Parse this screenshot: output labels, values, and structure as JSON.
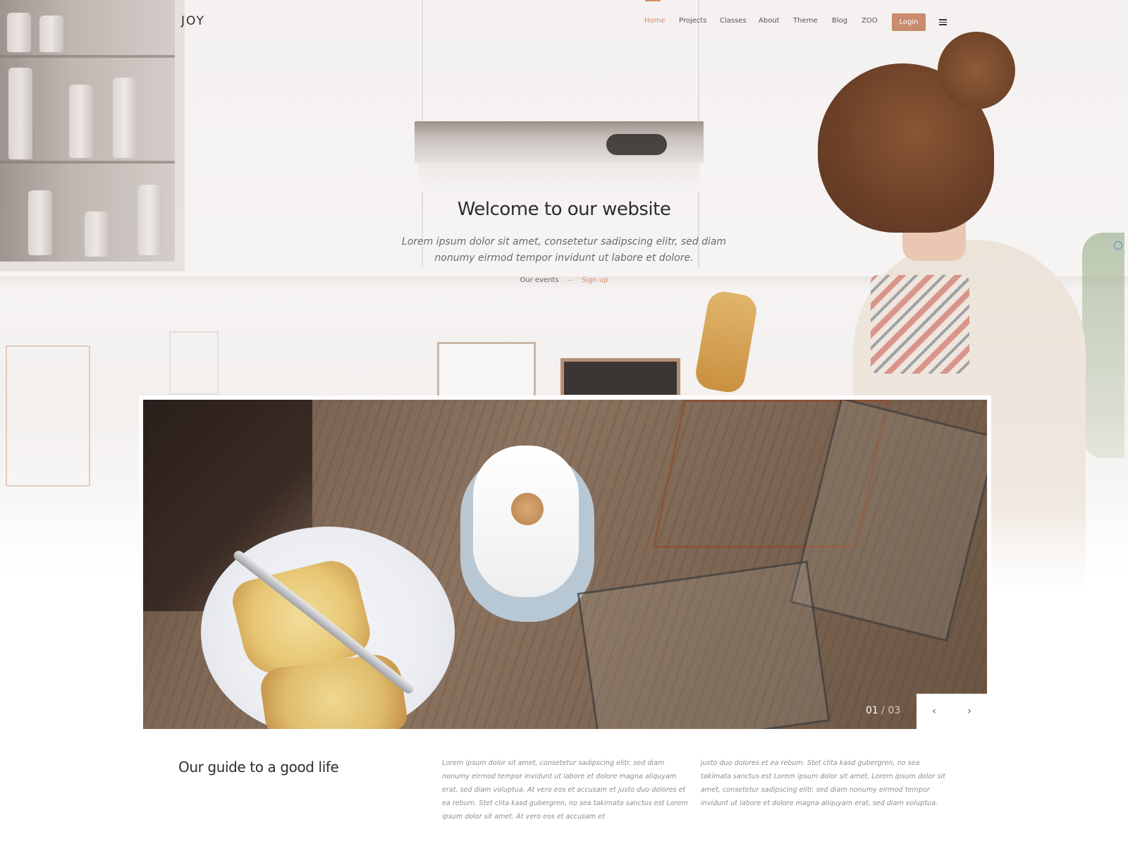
{
  "header": {
    "logo": "JOY",
    "nav": [
      {
        "label": "Home",
        "active": true
      },
      {
        "label": "Projects",
        "active": false
      },
      {
        "label": "Classes",
        "active": false
      },
      {
        "label": "About",
        "active": false
      },
      {
        "label": "Theme",
        "active": false
      },
      {
        "label": "Blog",
        "active": false
      },
      {
        "label": "ZOO",
        "active": false
      }
    ],
    "login_label": "Login",
    "menu_icon": "hamburger-icon"
  },
  "hero": {
    "title": "Welcome to our website",
    "subtitle": "Lorem ipsum dolor sit amet, consetetur sadipscing elitr, sed diam nonumy eirmod tempor invidunt ut labore et dolore.",
    "events_link": "Our events",
    "signup_link": "Sign up"
  },
  "slider": {
    "current": "01",
    "separator": "/",
    "total": "03",
    "prev_icon": "chevron-left-icon",
    "next_icon": "chevron-right-icon",
    "prev_glyph": "‹",
    "next_glyph": "›"
  },
  "guide": {
    "title": "Our guide to a good life",
    "col1": "Lorem ipsum dolor sit amet, consetetur sadipscing elitr, sed diam nonumy eirmod tempor invidunt ut labore et dolore magna aliquyam erat, sed diam voluptua. At vero eos et accusam et justo duo dolores et ea rebum. Stet clita kasd gubergren, no sea takimata sanctus est Lorem ipsum dolor sit amet. At vero eos et accusam et",
    "col2": "justo duo dolores et ea rebum. Stet clita kasd gubergren, no sea takimata sanctus est Lorem ipsum dolor sit amet. Lorem ipsum dolor sit amet, consetetur sadipscing elitr, sed diam nonumy eirmod tempor invidunt ut labore et dolore magna aliquyam erat, sed diam voluptua."
  },
  "colors": {
    "accent": "#d98d6b",
    "login_bg": "#c98b6d",
    "text_dark": "#2d2d2d",
    "text_muted": "#8e8e8e"
  }
}
